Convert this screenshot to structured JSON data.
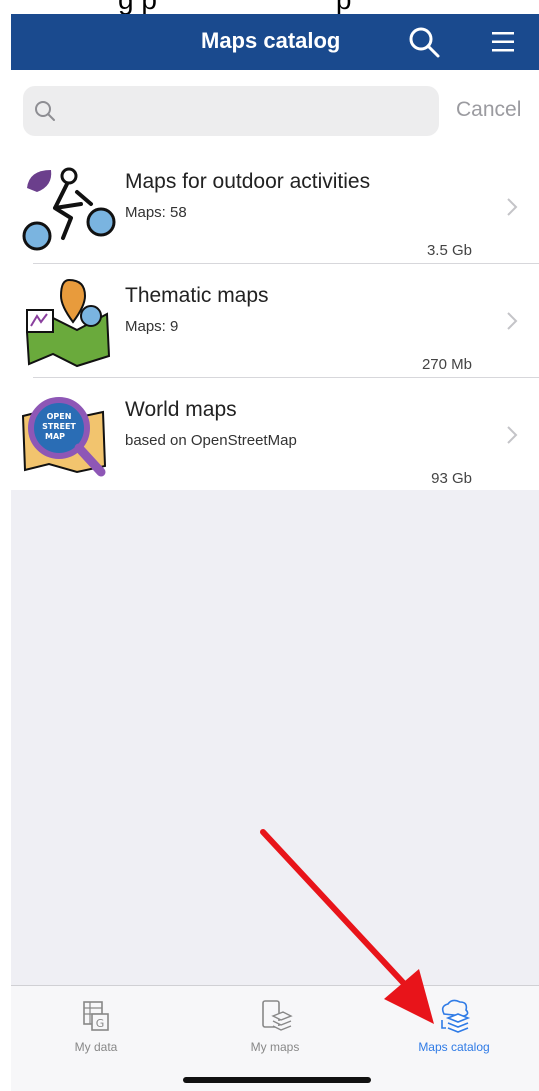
{
  "header": {
    "title": "Maps catalog"
  },
  "search": {
    "placeholder": "",
    "cancel_label": "Cancel"
  },
  "items": [
    {
      "title": "Maps for outdoor activities",
      "subtitle": "Maps: 58",
      "size": "3.5 Gb",
      "thumb": "cyclist-icon"
    },
    {
      "title": "Thematic maps",
      "subtitle": "Maps: 9",
      "size": "270 Mb",
      "thumb": "thematic-map-icon"
    },
    {
      "title": "World maps",
      "subtitle": "based on OpenStreetMap",
      "size": "93 Gb",
      "thumb": "openstreetmap-magnifier-icon",
      "logo_text": "OPEN STREET MAP"
    }
  ],
  "tabs": [
    {
      "label": "My data",
      "icon": "my-data-icon",
      "active": false
    },
    {
      "label": "My maps",
      "icon": "my-maps-icon",
      "active": false
    },
    {
      "label": "Maps catalog",
      "icon": "maps-catalog-icon",
      "active": true
    }
  ],
  "colors": {
    "header_bg": "#1a4a8e",
    "accent": "#2f7be6",
    "annotation_arrow": "#e8141a"
  }
}
